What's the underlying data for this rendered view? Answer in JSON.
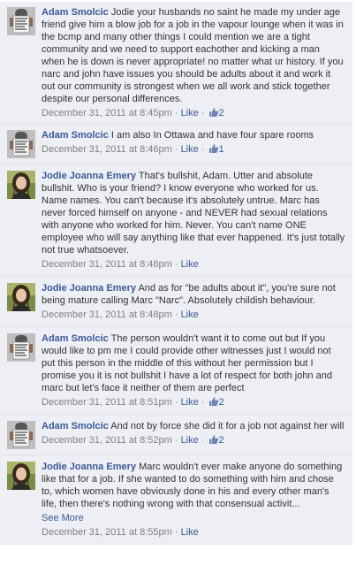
{
  "comments": [
    {
      "author": "Adam Smolcic",
      "text": "Jodie your husbands no saint he made my under age friend give him a blow job for a job in the vapour lounge when it was in the bcmp and many other things I could mention we are a tight community and we need to support eachother and kicking a man when he is down is never appropriate! no matter what ur history. If you narc and john have issues you should be adults about it and work it out our community is strongest when we all work and stick together despite our personal differences.",
      "timestamp": "December 31, 2011 at 8:45pm",
      "like_label": "Like",
      "likes": "2"
    },
    {
      "author": "Adam Smolcic",
      "text": "I am also In Ottawa and have four spare rooms",
      "timestamp": "December 31, 2011 at 8:46pm",
      "like_label": "Like",
      "likes": "1"
    },
    {
      "author": "Jodie Joanna Emery",
      "text": "That's bullshit, Adam. Utter and absolute bullshit. Who is your friend? I know everyone who worked for us. Name names. You can't because it's absolutely untrue. Marc has never forced himself on anyone - and NEVER had sexual relations with anyone who worked for him. Never. You can't name ONE employee who will say anything like that ever happened. It's just totally not true whatsoever.",
      "timestamp": "December 31, 2011 at 8:48pm",
      "like_label": "Like",
      "likes": ""
    },
    {
      "author": "Jodie Joanna Emery",
      "text": "And as for \"be adults about it\", you're sure not being mature calling Marc \"Narc\". Absolutely childish behaviour.",
      "timestamp": "December 31, 2011 at 8:48pm",
      "like_label": "Like",
      "likes": ""
    },
    {
      "author": "Adam Smolcic",
      "text": "The person wouldn't want it to come out but If you would like to pm me I could provide other witnesses just I would not put this person in the middle of this without her permission but I promise you it is not bullshit I have a lot of respect for both john and marc but let's face it neither of them are perfect",
      "timestamp": "December 31, 2011 at 8:51pm",
      "like_label": "Like",
      "likes": "2"
    },
    {
      "author": "Adam Smolcic",
      "text": "And not by force she did it for a job not against her will",
      "timestamp": "December 31, 2011 at 8:52pm",
      "like_label": "Like",
      "likes": "2"
    },
    {
      "author": "Jodie Joanna Emery",
      "text": "Marc wouldn't ever make anyone do something like that for a job. If she wanted to do something with him and chose to, which women have obviously done in his and every other man's life, then there's nothing wrong with that consensual activit...",
      "see_more": "See More",
      "timestamp": "December 31, 2011 at 8:55pm",
      "like_label": "Like",
      "likes": ""
    }
  ],
  "colors": {
    "author_link": "#3b5998",
    "comment_bg": "#edeff4",
    "meta_gray": "#808080"
  },
  "icons": {
    "adam_avatar": "avatar-photo-sign",
    "jodie_avatar": "avatar-photo-woman",
    "like": "thumbs-up-icon"
  }
}
